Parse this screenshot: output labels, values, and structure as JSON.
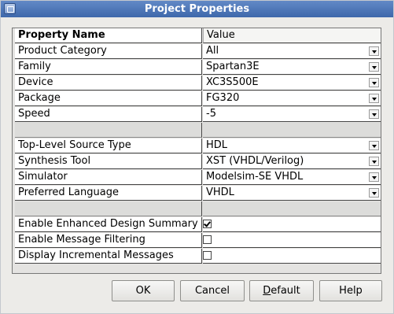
{
  "window": {
    "title": "Project Properties"
  },
  "table": {
    "header": {
      "name": "Property Name",
      "value": "Value"
    },
    "rows": [
      {
        "name": "Product Category",
        "value": "All"
      },
      {
        "name": "Family",
        "value": "Spartan3E"
      },
      {
        "name": "Device",
        "value": "XC3S500E"
      },
      {
        "name": "Package",
        "value": "FG320"
      },
      {
        "name": "Speed",
        "value": "-5"
      },
      {
        "name": "Top-Level Source Type",
        "value": "HDL"
      },
      {
        "name": "Synthesis Tool",
        "value": "XST (VHDL/Verilog)"
      },
      {
        "name": "Simulator",
        "value": "Modelsim-SE VHDL"
      },
      {
        "name": "Preferred Language",
        "value": "VHDL"
      },
      {
        "name": "Enable Enhanced Design Summary",
        "checked": true
      },
      {
        "name": "Enable Message Filtering",
        "checked": false
      },
      {
        "name": "Display Incremental Messages",
        "checked": false
      }
    ]
  },
  "buttons": {
    "ok": "OK",
    "cancel": "Cancel",
    "default_mnemonic": "D",
    "default_rest": "efault",
    "help": "Help"
  }
}
